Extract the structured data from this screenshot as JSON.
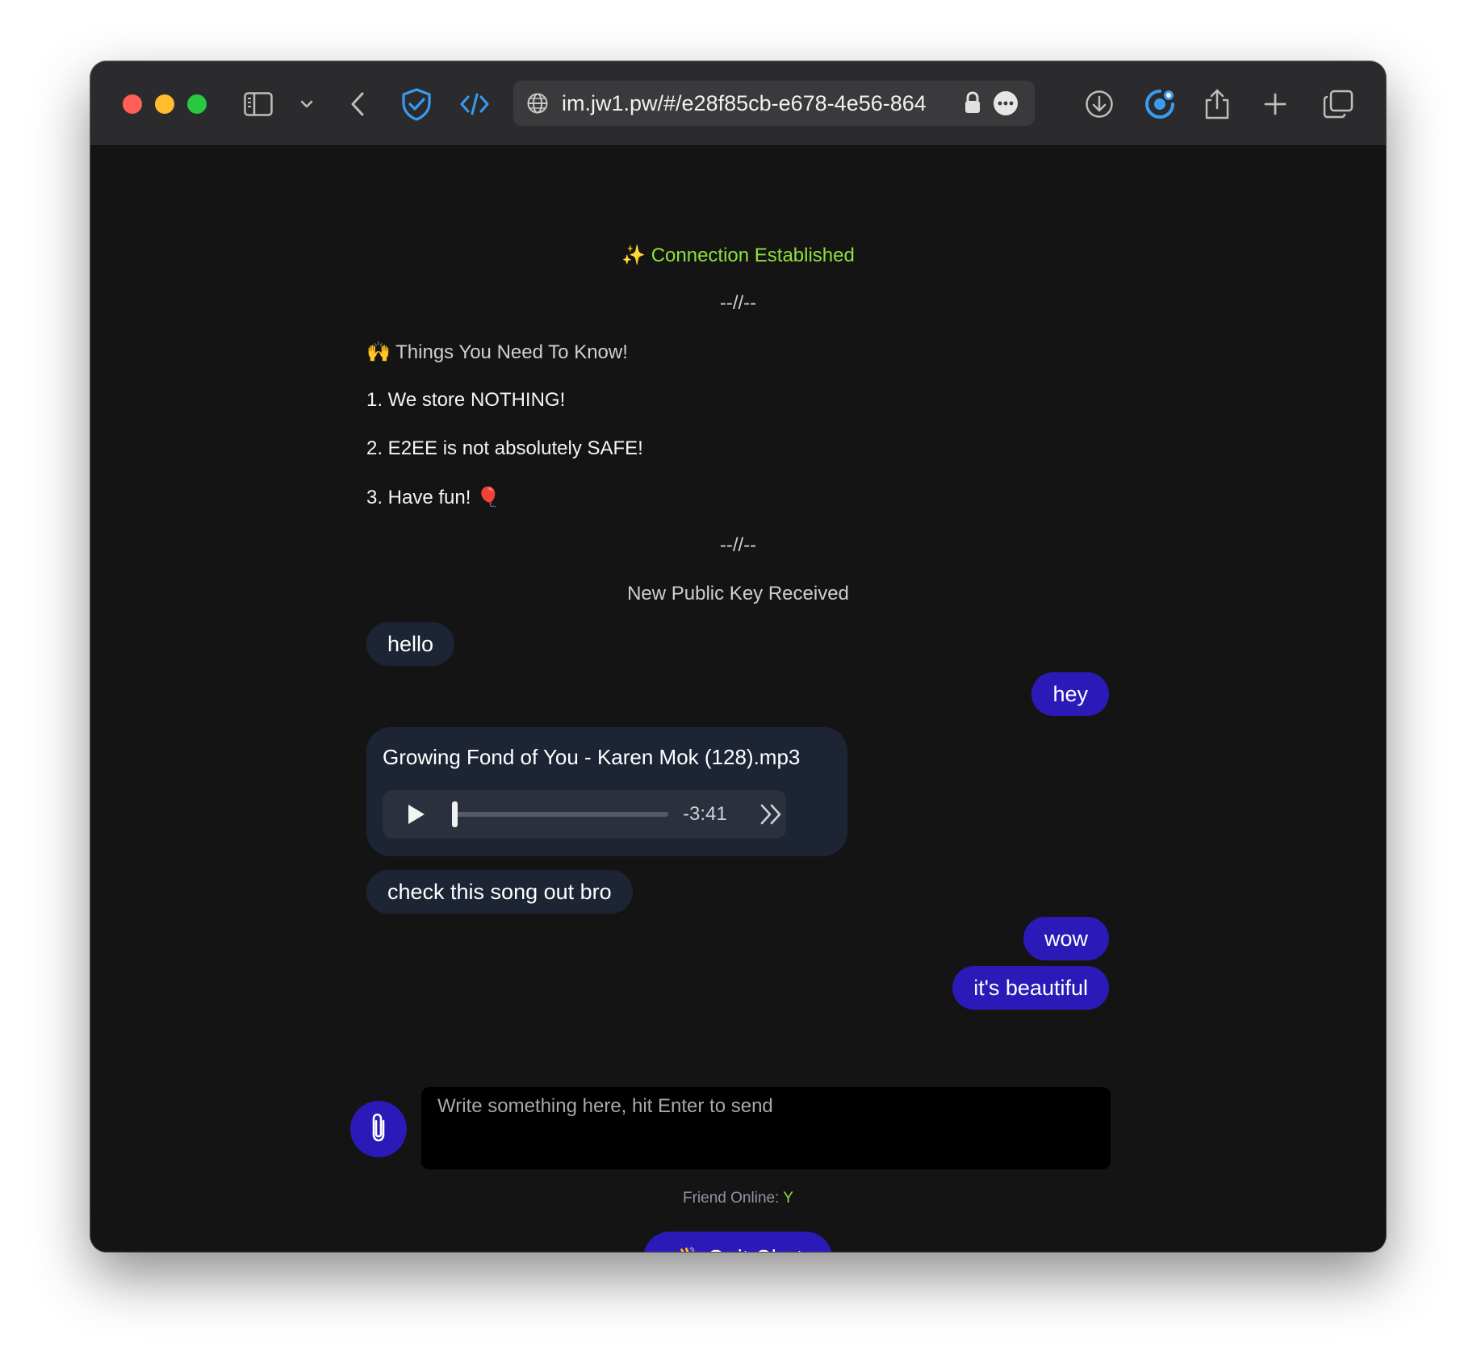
{
  "browser": {
    "url": "im.jw1.pw/#/e28f85cb-e678-4e56-864"
  },
  "chat": {
    "connection": "Connection Established",
    "connection_emoji": "✨",
    "divider": "--//--",
    "notice_title": "Things You Need To Know!",
    "notice_emoji": "🙌",
    "rules": [
      "1. We store NOTHING!",
      "2. E2EE is not absolutely SAFE!",
      "3. Have fun!"
    ],
    "rule3_emoji": "🎈",
    "key_notice": "New Public Key Received",
    "messages": [
      {
        "from": "friend",
        "text": "hello"
      },
      {
        "from": "me",
        "text": "hey"
      },
      {
        "from": "friend",
        "type": "audio",
        "filename": "Growing Fond of You - Karen Mok (128).mp3",
        "remaining": "-3:41",
        "progress": 0
      },
      {
        "from": "friend",
        "text": "check this song out bro"
      },
      {
        "from": "me",
        "text": "wow"
      },
      {
        "from": "me",
        "text": "it's beautiful"
      }
    ]
  },
  "composer": {
    "placeholder": "Write something here, hit Enter to send"
  },
  "status": {
    "label": "Friend Online:",
    "value": "Y"
  },
  "quit": {
    "emoji": "👋",
    "label": "Quit Chat"
  },
  "colors": {
    "accent": "#2c1ab8",
    "connection": "#8ee03c",
    "incoming_bubble": "#1d2433",
    "background": "#141414"
  }
}
